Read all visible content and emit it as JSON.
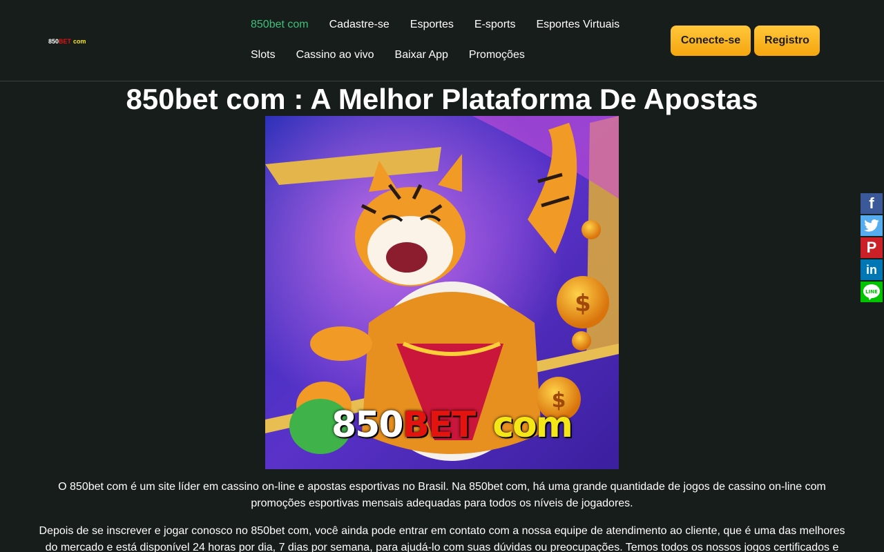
{
  "header": {
    "logo": {
      "part1": "850",
      "part2": "BET",
      "part3": "com"
    },
    "nav": [
      {
        "label": "850bet com",
        "active": true
      },
      {
        "label": "Cadastre-se",
        "active": false
      },
      {
        "label": "Esportes",
        "active": false
      },
      {
        "label": "E-sports",
        "active": false
      },
      {
        "label": "Esportes Virtuais",
        "active": false
      },
      {
        "label": "Slots",
        "active": false
      },
      {
        "label": "Cassino ao vivo",
        "active": false
      },
      {
        "label": "Baixar App",
        "active": false
      },
      {
        "label": "Promoções",
        "active": false
      }
    ],
    "login_label": "Conecte-se",
    "register_label": "Registro"
  },
  "main": {
    "title": "850bet com : A Melhor Plataforma De Apostas",
    "hero": {
      "part1": "850",
      "part2": "BET",
      "part3": "com"
    },
    "paragraphs": [
      "O 850bet com é um site líder em cassino on-line e apostas esportivas no Brasil. Na 850bet com, há uma grande quantidade de jogos de cassino on-line com promoções esportivas mensais adequadas para todos os níveis de jogadores.",
      "Depois de se inscrever e jogar conosco no 850bet com, você ainda pode entrar em contato com a nossa equipe de atendimento ao cliente, que é uma das melhores do mercado e está disponível 24 horas por dia, 7 dias por semana, para ajudá-lo com suas dúvidas ou preocupações. Temos todos os nossos jogos certificados e"
    ]
  },
  "share": [
    {
      "name": "facebook-share-button",
      "icon": "facebook-icon"
    },
    {
      "name": "twitter-share-button",
      "icon": "twitter-icon"
    },
    {
      "name": "pinterest-share-button",
      "icon": "pinterest-icon"
    },
    {
      "name": "linkedin-share-button",
      "icon": "linkedin-icon"
    },
    {
      "name": "line-share-button",
      "icon": "line-icon"
    }
  ],
  "colors": {
    "background": "#171d1b",
    "nav_active": "#3dc07a",
    "button": "#f5a50f",
    "brand_red": "#e3140f",
    "brand_yellow": "#f5e617"
  }
}
